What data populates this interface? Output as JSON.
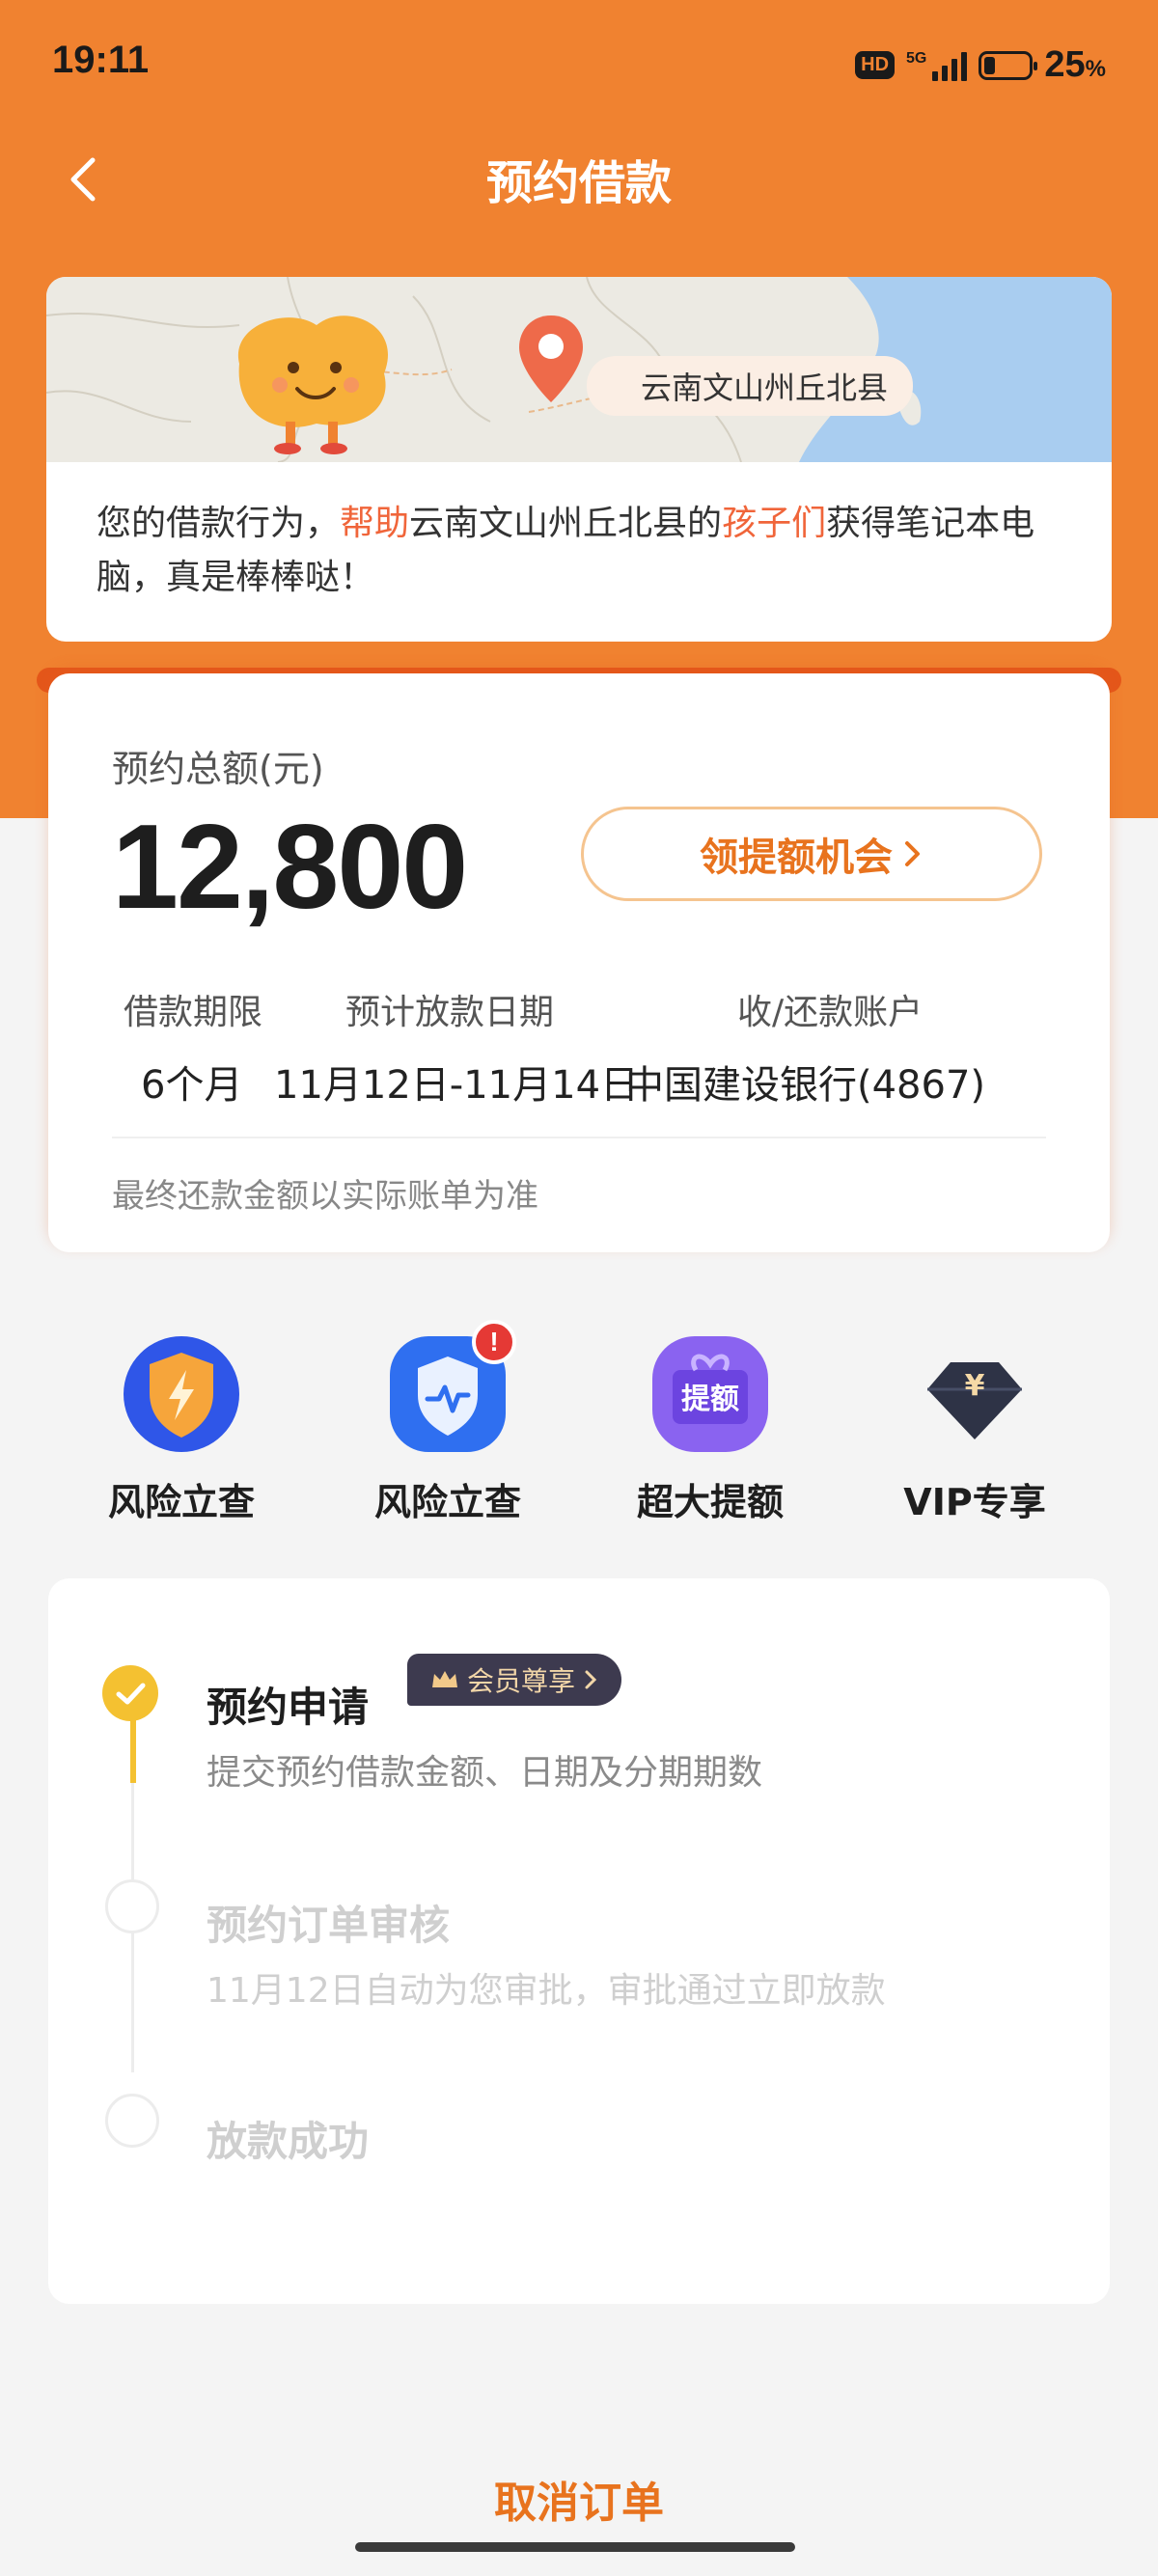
{
  "status_bar": {
    "time": "19:11",
    "hd": "HD",
    "network": "5G",
    "battery_percent": "25",
    "battery_unit": "%",
    "battery_level": 0.25
  },
  "nav": {
    "title": "预约借款"
  },
  "map_card": {
    "location_label": "云南文山州丘北县",
    "text_parts": [
      "您的借款行为，",
      "帮助",
      "云南文山州丘北县",
      "的",
      "孩子们",
      "获得笔记本电脑，真是棒棒哒！"
    ]
  },
  "summary": {
    "total_label": "预约总额(元)",
    "total_amount": "12,800",
    "quota_button": "领提额机会",
    "term_label": "借款期限",
    "term_value": "6个月",
    "date_label": "预计放款日期",
    "date_value": "11月12日-11月14日",
    "account_label": "收/还款账户",
    "account_value": "中国建设银行(4867)",
    "note": "最终还款金额以实际账单为准"
  },
  "actions": [
    {
      "label": "风险立查",
      "icon": "shield-bolt-icon"
    },
    {
      "label": "风险立查",
      "icon": "shield-pulse-icon",
      "badge": "!"
    },
    {
      "label": "超大提额",
      "icon": "gift-quota-icon",
      "icon_text": "提额"
    },
    {
      "label": "VIP专享",
      "icon": "diamond-yen-icon",
      "icon_text": "¥"
    }
  ],
  "progress": {
    "member_tag": "会员尊享",
    "steps": [
      {
        "title": "预约申请",
        "desc": "提交预约借款金额、日期及分期期数",
        "status": "done"
      },
      {
        "title": "预约订单审核",
        "desc": "11月12日自动为您审批，审批通过立即放款",
        "status": "pending"
      },
      {
        "title": "放款成功",
        "status": "pending"
      }
    ]
  },
  "footer": {
    "cancel_label": "取消订单"
  },
  "colors": {
    "brand_orange": "#f08230",
    "accent": "#e8731e",
    "highlight": "#f0653a",
    "step_done": "#f4c131"
  }
}
